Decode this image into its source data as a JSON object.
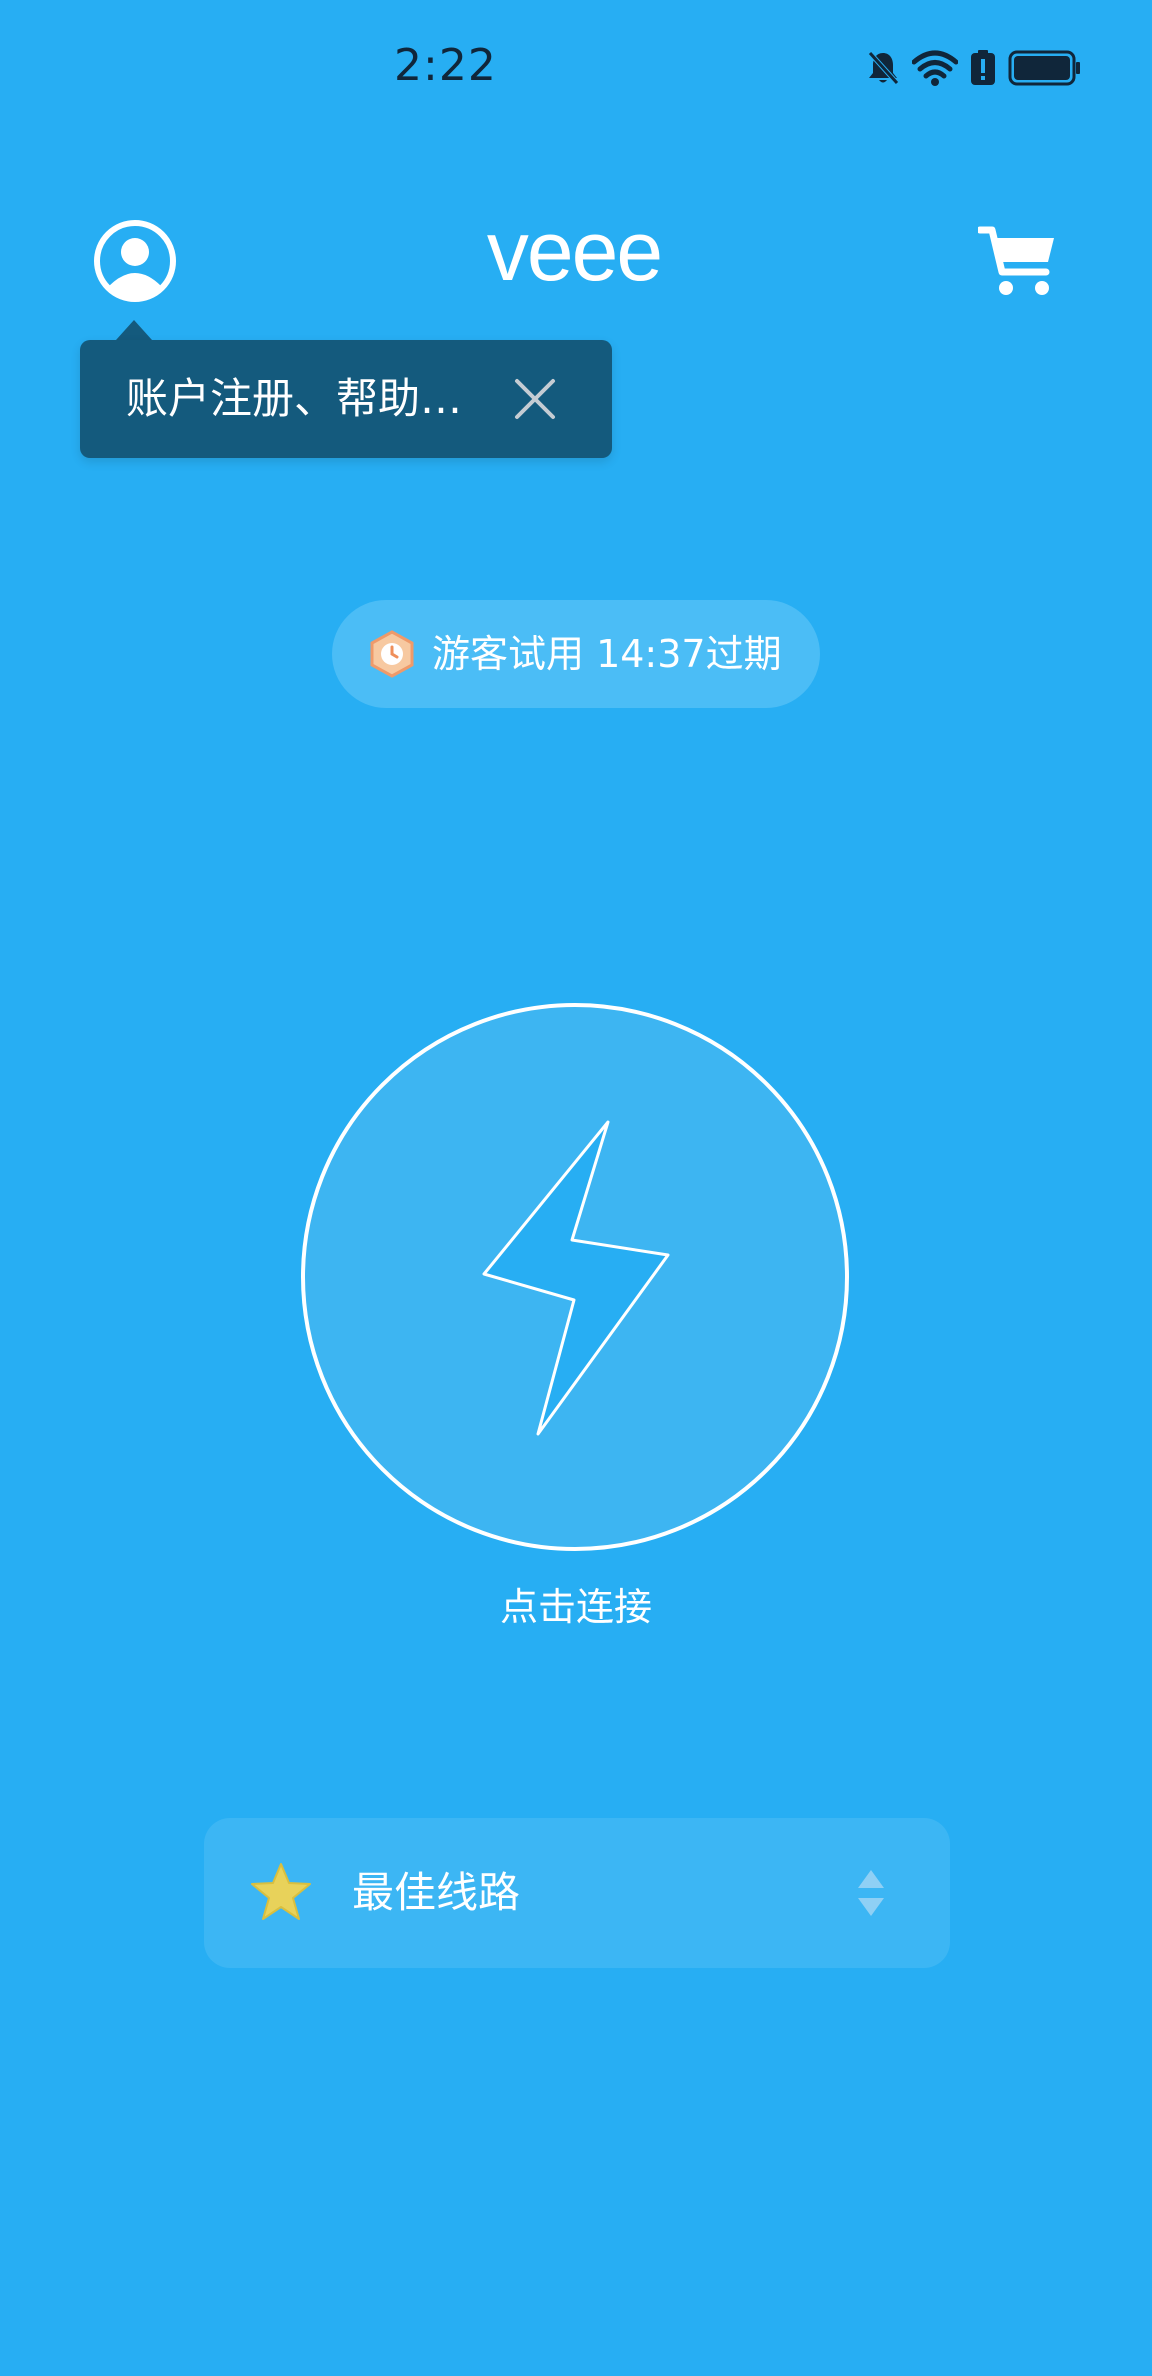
{
  "status_bar": {
    "time": "2:22",
    "icons": [
      "bell-muted-icon",
      "wifi-icon",
      "battery-alert-icon",
      "battery-icon"
    ]
  },
  "header": {
    "logo_text": "veee",
    "account_icon": "user-circle-icon",
    "cart_icon": "cart-icon"
  },
  "tooltip": {
    "text": "账户注册、帮助…",
    "close_icon": "close-icon"
  },
  "trial": {
    "text": "游客试用 14:37过期",
    "icon": "clock-badge-icon"
  },
  "connect": {
    "label": "点击连接",
    "icon": "lightning-icon"
  },
  "route": {
    "label": "最佳线路",
    "icon": "star-icon",
    "toggle_icon": "up-down-arrows-icon"
  },
  "colors": {
    "background": "#27aef3",
    "tooltip_bg": "#145a7d",
    "badge_bg": "#4bbdf6",
    "route_bg": "#3cb6f4",
    "connect_fill": "#3db5f2",
    "star": "#e8d25a"
  }
}
